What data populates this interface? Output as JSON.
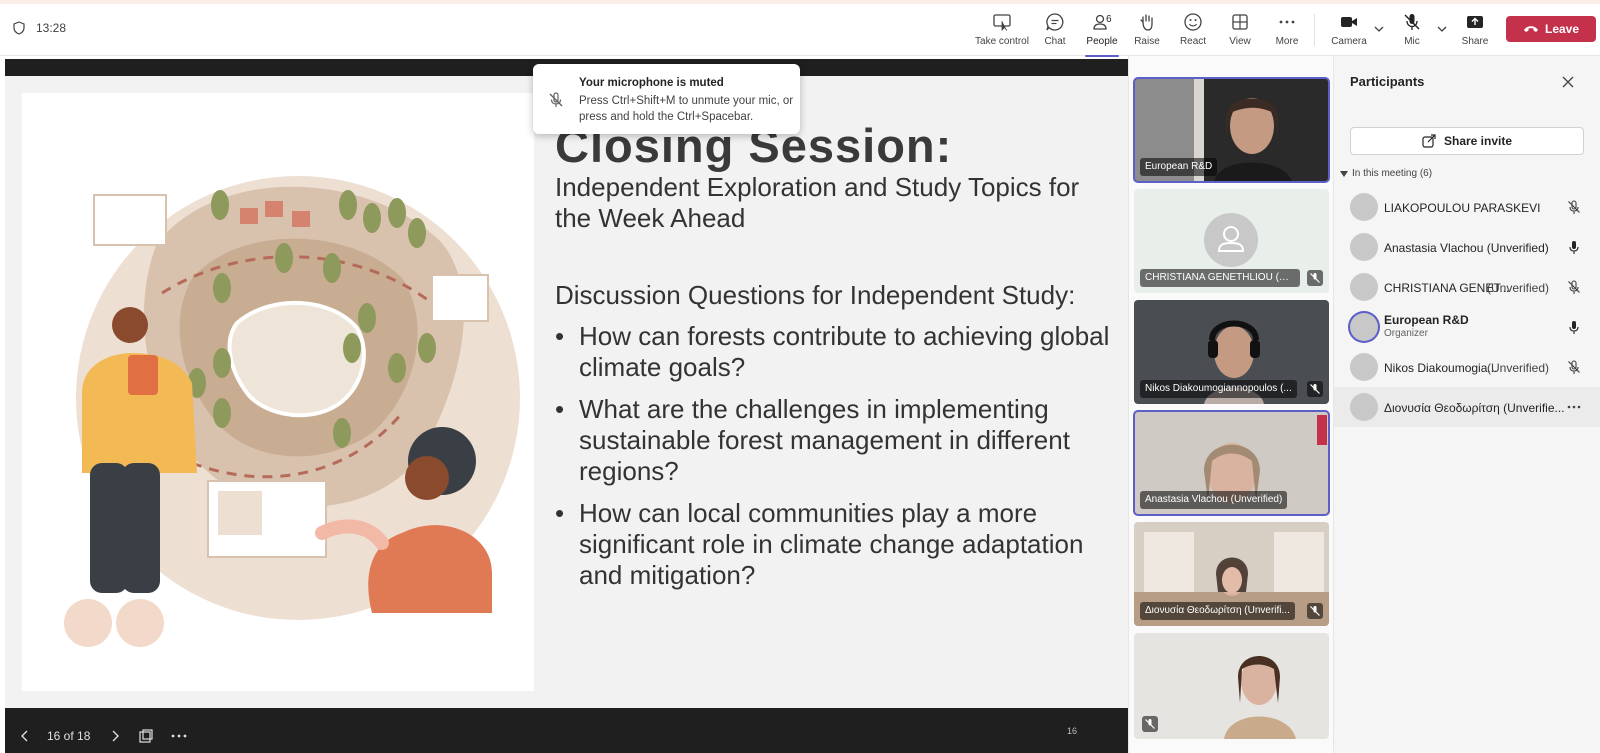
{
  "meeting": {
    "time": "13:28"
  },
  "toolbar": {
    "take_control": "Take control",
    "chat": "Chat",
    "people": "People",
    "people_count": "6",
    "raise": "Raise",
    "react": "React",
    "view": "View",
    "more": "More",
    "camera": "Camera",
    "mic": "Mic",
    "share": "Share",
    "leave": "Leave"
  },
  "toast": {
    "title": "Your microphone is muted",
    "body": "Press Ctrl+Shift+M to unmute your mic, or press and hold the Ctrl+Spacebar."
  },
  "slide": {
    "title": "Closing Session:",
    "subtitle": "Independent Exploration and Study Topics for the Week Ahead",
    "questions_heading": "Discussion Questions for Independent Study:",
    "questions": [
      "How can forests contribute to achieving global climate goals?",
      "What are the challenges in implementing sustainable forest management in different regions?",
      "How can local communities play a more significant role in climate change adaptation and mitigation?"
    ],
    "page_number": "16"
  },
  "slide_controls": {
    "position": "16 of 18"
  },
  "video_tiles": [
    {
      "name": "European R&D",
      "muted": false
    },
    {
      "name": "CHRISTIANA GENETHLIOU (Unv...",
      "muted": true
    },
    {
      "name": "Nikos Diakoumogiannopoulos (...",
      "muted": true
    },
    {
      "name": "Anastasia Vlachou (Unverified)",
      "muted": false
    },
    {
      "name": "Διονυσία Θεοδωρίτση (Unverifi...",
      "muted": true
    },
    {
      "name": "",
      "muted": true
    }
  ],
  "participants": {
    "title": "Participants",
    "share_invite": "Share invite",
    "section": "In this meeting (6)",
    "list": [
      {
        "name": "LIAKOPOULOU PARASKEVI",
        "status": "",
        "role": "",
        "mic": "muted"
      },
      {
        "name": "Anastasia Vlachou (Unverified)",
        "status": "",
        "role": "",
        "mic": "on"
      },
      {
        "name": "CHRISTIANA GENET...",
        "status": "(Unverified)",
        "role": "",
        "mic": "muted"
      },
      {
        "name": "European R&D",
        "status": "",
        "role": "Organizer",
        "mic": "on"
      },
      {
        "name": "Nikos Diakoumogia...",
        "status": "(Unverified)",
        "role": "",
        "mic": "muted"
      },
      {
        "name": "Διονυσία Θεοδωρίτση (Unverifie...",
        "status": "",
        "role": "",
        "mic": "more"
      }
    ]
  }
}
